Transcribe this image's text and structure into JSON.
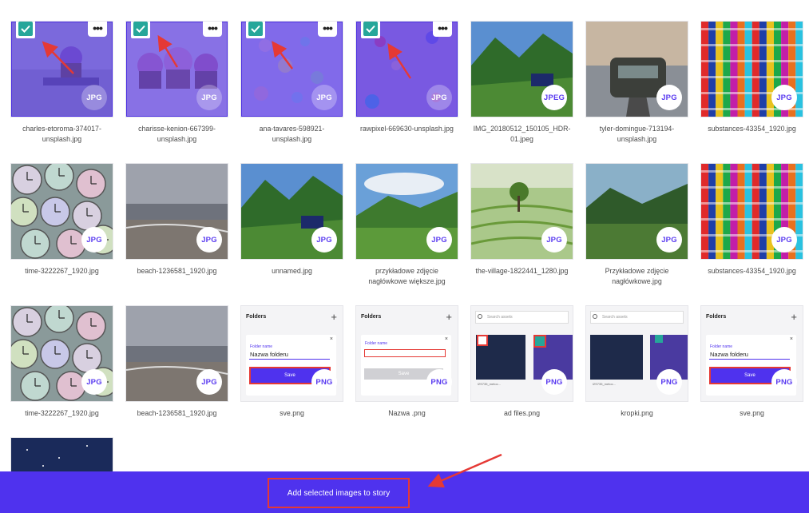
{
  "colors": {
    "accent": "#4f32ee",
    "check": "#26a69a",
    "highlight": "#e53935",
    "badge_text": "#5b3cf0"
  },
  "assets": [
    {
      "id": "a1",
      "name": "charles-etoroma-374017-unsplash.jpg",
      "badge": "JPG",
      "selected": true,
      "theme": "cupcake"
    },
    {
      "id": "a2",
      "name": "charisse-kenion-667399-unsplash.jpg",
      "badge": "JPG",
      "selected": true,
      "theme": "cupcakes"
    },
    {
      "id": "a3",
      "name": "ana-tavares-598921-unsplash.jpg",
      "badge": "JPG",
      "selected": true,
      "theme": "sweets"
    },
    {
      "id": "a4",
      "name": "rawpixel-669630-unsplash.jpg",
      "badge": "JPG",
      "selected": true,
      "theme": "candy"
    },
    {
      "id": "a5",
      "name": "IMG_20180512_150105_HDR-01.jpeg",
      "badge": "JPEG",
      "selected": false,
      "theme": "mountain"
    },
    {
      "id": "a6",
      "name": "tyler-domingue-713194-unsplash.jpg",
      "badge": "JPG",
      "selected": false,
      "theme": "road"
    },
    {
      "id": "a7",
      "name": "substances-43354_1920.jpg",
      "badge": "JPG",
      "selected": false,
      "theme": "fabric"
    },
    {
      "id": "a8",
      "name": "time-3222267_1920.jpg",
      "badge": "JPG",
      "selected": false,
      "theme": "clocks"
    },
    {
      "id": "a9",
      "name": "beach-1236581_1920.jpg",
      "badge": "JPG",
      "selected": false,
      "theme": "beach"
    },
    {
      "id": "a10",
      "name": "unnamed.jpg",
      "badge": "JPG",
      "selected": false,
      "theme": "mountain"
    },
    {
      "id": "a11",
      "name": "przykładowe zdjęcie nagłówkowe większe.jpg",
      "badge": "JPG",
      "selected": false,
      "theme": "valley"
    },
    {
      "id": "a12",
      "name": "the-village-1822441_1280.jpg",
      "badge": "JPG",
      "selected": false,
      "theme": "rice"
    },
    {
      "id": "a13",
      "name": "Przykładowe zdjęcie nagłówkowe.jpg",
      "badge": "JPG",
      "selected": false,
      "theme": "hills"
    },
    {
      "id": "a14",
      "name": "substances-43354_1920.jpg",
      "badge": "JPG",
      "selected": false,
      "theme": "fabric"
    },
    {
      "id": "a15",
      "name": "time-3222267_1920.jpg",
      "badge": "JPG",
      "selected": false,
      "theme": "clocks"
    },
    {
      "id": "a16",
      "name": "beach-1236581_1920.jpg",
      "badge": "JPG",
      "selected": false,
      "theme": "beach"
    },
    {
      "id": "a17",
      "name": "sve.png",
      "badge": "PNG",
      "selected": false,
      "theme": "folders-save"
    },
    {
      "id": "a18",
      "name": "Nazwa .png",
      "badge": "PNG",
      "selected": false,
      "theme": "folders-empty"
    },
    {
      "id": "a19",
      "name": "ad files.png",
      "badge": "PNG",
      "selected": false,
      "theme": "search-assets"
    },
    {
      "id": "a20",
      "name": "kropki.png",
      "badge": "PNG",
      "selected": false,
      "theme": "search-assets2"
    },
    {
      "id": "a21",
      "name": "sve.png",
      "badge": "PNG",
      "selected": false,
      "theme": "folders-save"
    },
    {
      "id": "a22",
      "name": "",
      "badge": "",
      "selected": false,
      "theme": "night"
    }
  ],
  "mini_ui": {
    "folders_title": "Folders",
    "folder_name_label": "Folder name",
    "folder_name_value": "Nazwa folderu",
    "save_label": "Save",
    "search_placeholder": "Search assets"
  },
  "footer": {
    "add_button": "Add selected images to story"
  }
}
